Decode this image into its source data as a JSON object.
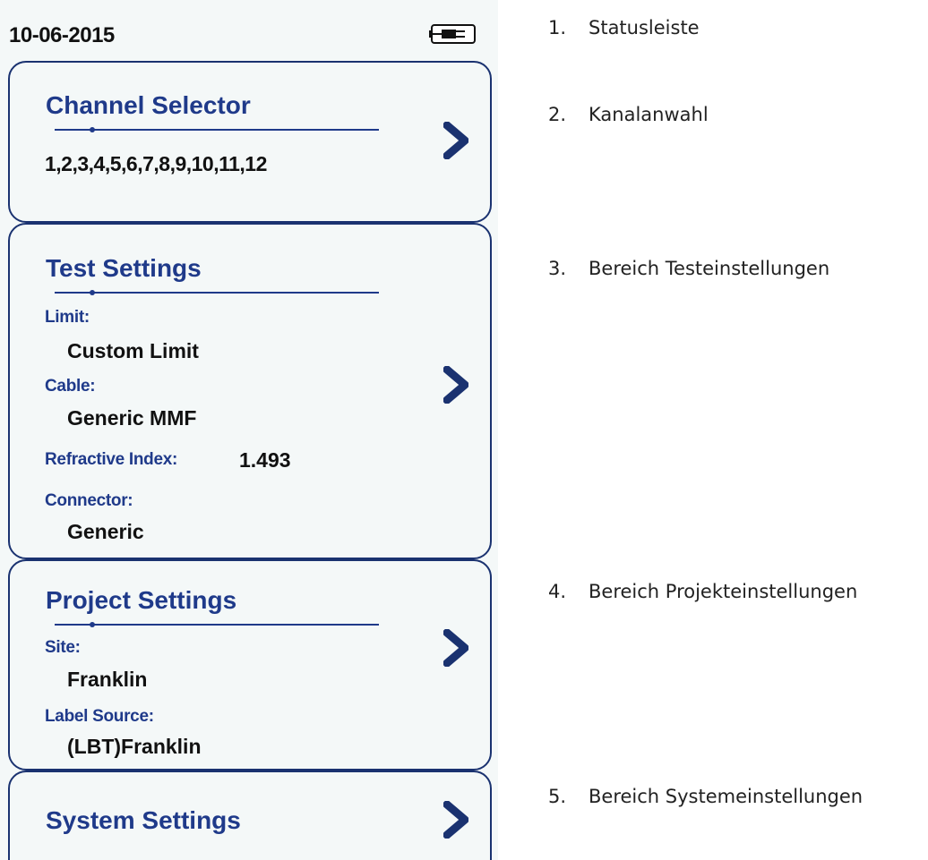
{
  "statusbar": {
    "date": "10-06-2015",
    "battery_icon": "battery-plug-icon"
  },
  "channel_selector": {
    "title": "Channel Selector",
    "channels": "1,2,3,4,5,6,7,8,9,10,11,12"
  },
  "test_settings": {
    "title": "Test Settings",
    "limit_label": "Limit:",
    "limit_value": "Custom Limit",
    "cable_label": "Cable:",
    "cable_value": "Generic MMF",
    "refractive_label": "Refractive Index:",
    "refractive_value": "1.493",
    "connector_label": "Connector:",
    "connector_value": "Generic"
  },
  "project_settings": {
    "title": "Project Settings",
    "site_label": "Site:",
    "site_value": "Franklin",
    "label_source_label": "Label Source:",
    "label_source_value": "(LBT)Franklin"
  },
  "system_settings": {
    "title": "System Settings"
  },
  "callouts": [
    {
      "num": "1.",
      "text": "Statusleiste"
    },
    {
      "num": "2.",
      "text": "Kanalanwahl"
    },
    {
      "num": "3.",
      "text": "Bereich Testeinstellungen"
    },
    {
      "num": "4.",
      "text": "Bereich Projekteinstellungen"
    },
    {
      "num": "5.",
      "text": "Bereich Systemeinstellungen"
    }
  ],
  "colors": {
    "accent": "#1f3a8a",
    "border": "#1a3270",
    "screen_bg": "#f4f8f8",
    "text": "#111111"
  }
}
